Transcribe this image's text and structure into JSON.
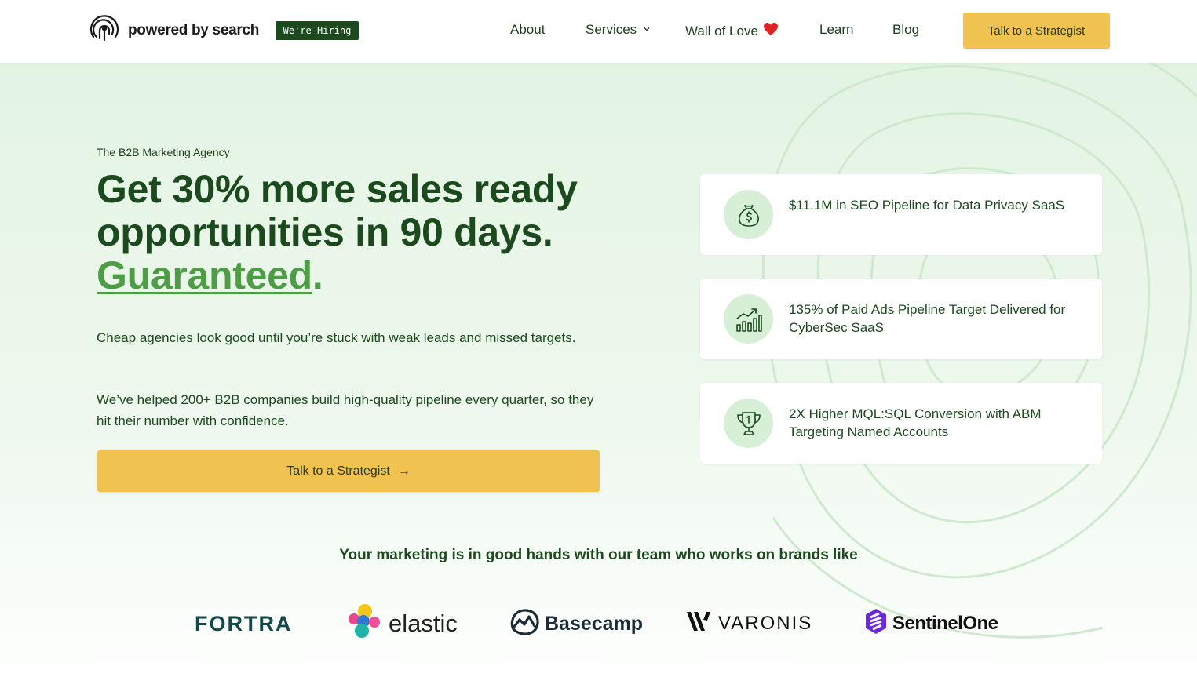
{
  "header": {
    "logo_text": "powered by search",
    "hiring_badge": "We're Hiring",
    "nav": {
      "about": "About",
      "services": "Services",
      "wall_of_love": "Wall of Love",
      "learn": "Learn",
      "blog": "Blog"
    },
    "cta": "Talk to a Strategist"
  },
  "hero": {
    "eyebrow": "The B2B Marketing Agency",
    "headline_line1": "Get 30% more sales ready",
    "headline_line2": "opportunities in 90 days.",
    "headline_accent": "Guaranteed",
    "headline_dot": ".",
    "paragraph1": "Cheap agencies look good until you’re stuck with weak leads and missed targets.",
    "paragraph2": "We’ve helped 200+ B2B companies build high-quality pipeline every quarter, so they hit their number with confidence.",
    "cta": "Talk to a Strategist",
    "cta_arrow": "→"
  },
  "stats": [
    {
      "icon": "money-bag-icon",
      "text": "$11.1M in SEO Pipeline for Data Privacy SaaS"
    },
    {
      "icon": "growth-chart-icon",
      "text": "135% of Paid Ads Pipeline Target Delivered for CyberSec SaaS"
    },
    {
      "icon": "trophy-icon",
      "text": "2X Higher MQL:SQL Conversion with ABM Targeting Named Accounts"
    }
  ],
  "brands": {
    "title": "Your marketing is in good hands with our team who works on brands like",
    "fortra": "FORTRA",
    "elastic": "elastic",
    "basecamp": "Basecamp",
    "varonis": "VARONIS",
    "sentinelone": "SentinelOne"
  },
  "colors": {
    "primary_green": "#1c4a1e",
    "accent_green": "#4e9d46",
    "cta_yellow": "#f0c24f",
    "hero_bg": "#e3f4e3"
  }
}
